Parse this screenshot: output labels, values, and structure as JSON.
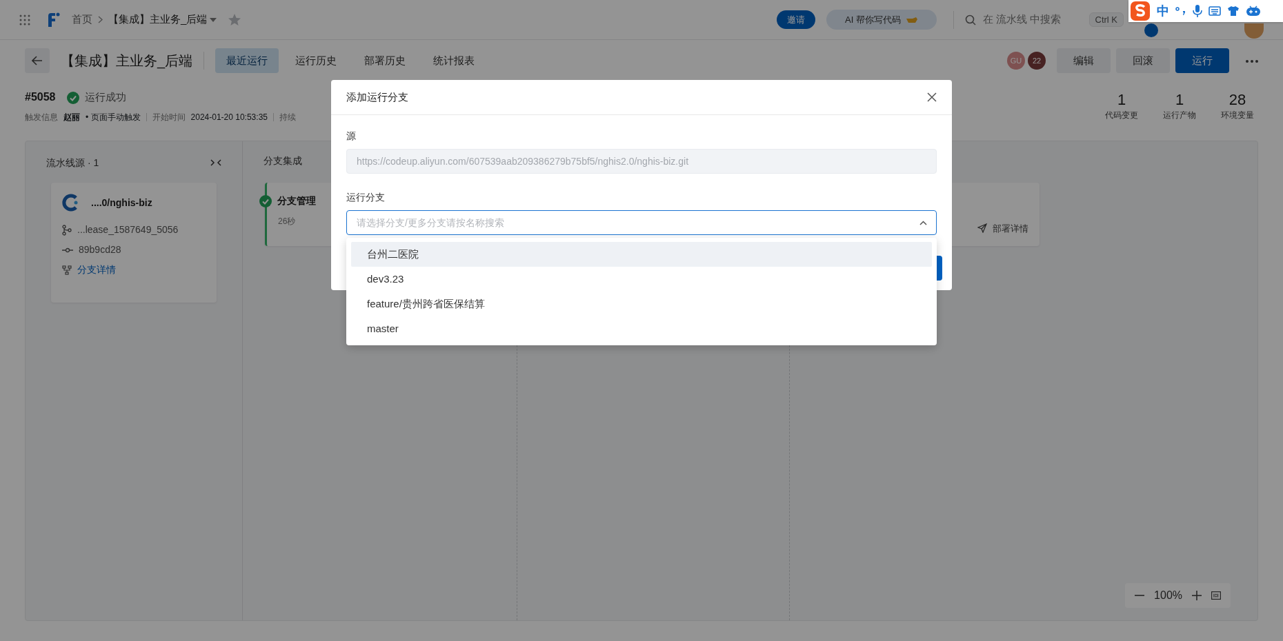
{
  "topbar": {
    "breadcrumb": [
      {
        "label": "首页"
      },
      {
        "label": "【集成】主业务_后端"
      }
    ],
    "invite": "邀请",
    "ai_button": "AI 帮你写代码",
    "search": {
      "placeholder": "在 流水线 中搜索"
    },
    "shortcut": "Ctrl K"
  },
  "ime_toolbar": {
    "mode": "中"
  },
  "header": {
    "title": "【集成】主业务_后端",
    "tabs": [
      {
        "label": "最近运行",
        "selected": true
      },
      {
        "label": "运行历史",
        "selected": false
      },
      {
        "label": "部署历史",
        "selected": false
      },
      {
        "label": "统计报表",
        "selected": false
      }
    ],
    "avatars": [
      {
        "text": "GU"
      },
      {
        "text": "22"
      }
    ],
    "buttons": [
      {
        "label": "编辑",
        "kind": "secondary"
      },
      {
        "label": "回滚",
        "kind": "secondary"
      },
      {
        "label": "运行",
        "kind": "primary"
      }
    ]
  },
  "run": {
    "number": "#5058",
    "status": "运行成功",
    "trigger_label": "触发信息",
    "trigger_user": "赵丽",
    "trigger_kind": "• 页面手动触发",
    "start_label": "开始时间",
    "start_time": "2024-01-20 10:53:35",
    "duration_label": "持续"
  },
  "stats": [
    {
      "value": "1",
      "label": "代码变更"
    },
    {
      "value": "1",
      "label": "运行产物"
    },
    {
      "value": "28",
      "label": "环境变量"
    }
  ],
  "canvas": {
    "source_column": {
      "title": "流水线源 · 1",
      "repo": "....0/nghis-biz",
      "branch": "...lease_1587649_5056",
      "commit": "89b9cd28",
      "link": "分支详情"
    },
    "integration_column": {
      "title": "分支集成",
      "stage": {
        "name": "分支管理",
        "duration": "26秒",
        "succeeded": true
      }
    },
    "deploy_card": {
      "link": "部署详情"
    },
    "zoom": "100%"
  },
  "modal": {
    "title": "添加运行分支",
    "source_label": "源",
    "source_value": "https://codeup.aliyun.com/607539aab209386279b75bf5/nghis2.0/nghis-biz.git",
    "branch_label": "运行分支",
    "branch_select": {
      "placeholder": "请选择分支/更多分支请按名称搜索",
      "expanded": true
    },
    "options": [
      {
        "label": "台州二医院",
        "selected": true
      },
      {
        "label": "dev3.23",
        "selected": false
      },
      {
        "label": "feature/贵州跨省医保结算",
        "selected": false
      },
      {
        "label": "master",
        "selected": false
      }
    ]
  }
}
